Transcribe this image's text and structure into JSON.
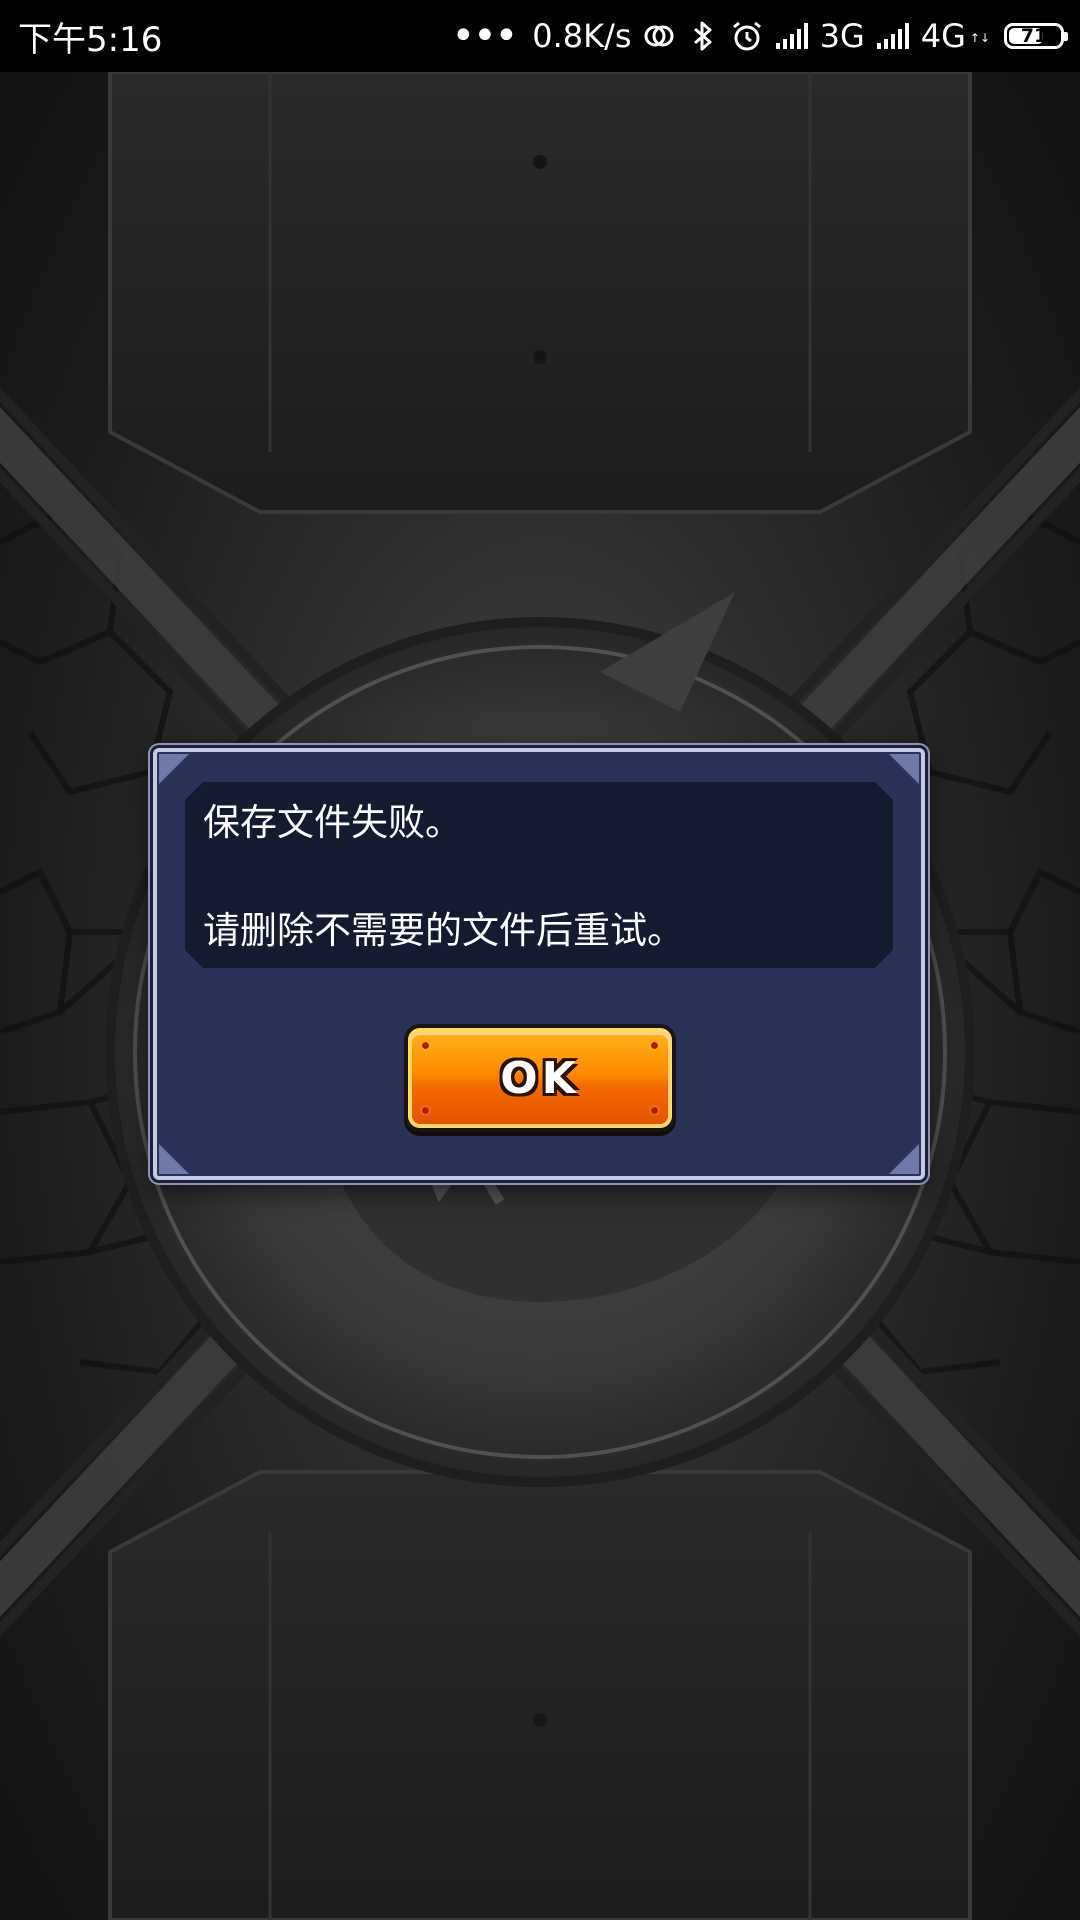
{
  "status_bar": {
    "time": "下午5:16",
    "more_dots": "•••",
    "net_speed": "0.8K/s",
    "network_1": "3G",
    "network_2": "4G",
    "network_2_sub": "↑↓",
    "battery_level": "71",
    "battery_percent": 71,
    "icons": [
      "hotspot-icon",
      "bluetooth-icon",
      "alarm-icon",
      "signal-icon",
      "signal-icon"
    ]
  },
  "dialog": {
    "message_line_1": "保存文件失败。",
    "message_line_2": "请删除不需要的文件后重试。",
    "ok_label": "OK"
  },
  "colors": {
    "dialog_bg": "#2a3258",
    "message_bg": "#141a30",
    "button_orange": "#ff8a00",
    "status_bar_bg": "#000000"
  }
}
